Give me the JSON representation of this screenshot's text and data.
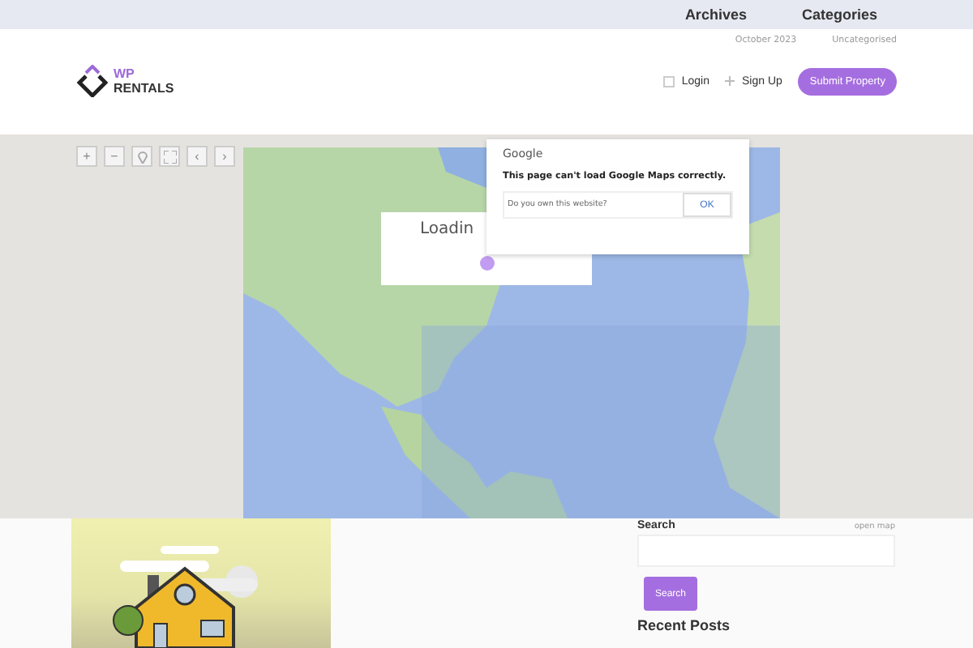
{
  "top_nav": {
    "items": [
      "Archives",
      "Categories"
    ]
  },
  "sub_nav": {
    "items": [
      "October 2023",
      "Uncategorised"
    ]
  },
  "logo": {
    "line_1": "WP",
    "line_2": "RENTALS"
  },
  "header_actions": {
    "login": "Login",
    "sign_up": "Sign Up",
    "submit": "Submit Property"
  },
  "map_controls": [
    {
      "kind": "text",
      "label": "+"
    },
    {
      "kind": "text",
      "label": "−"
    },
    {
      "kind": "pin"
    },
    {
      "kind": "fullscreen"
    },
    {
      "kind": "text",
      "label": "‹"
    },
    {
      "kind": "text",
      "label": "›"
    }
  ],
  "loading": {
    "text": "Loadin"
  },
  "map_error_dialog": {
    "brand": "Google",
    "message": "This page can't load Google Maps correctly.",
    "question": "Do you own this website?",
    "button": "OK"
  },
  "sidebar": {
    "search_label": "Search",
    "open_map": "open map",
    "search_button": "Search",
    "recent_posts_heading": "Recent Posts"
  }
}
